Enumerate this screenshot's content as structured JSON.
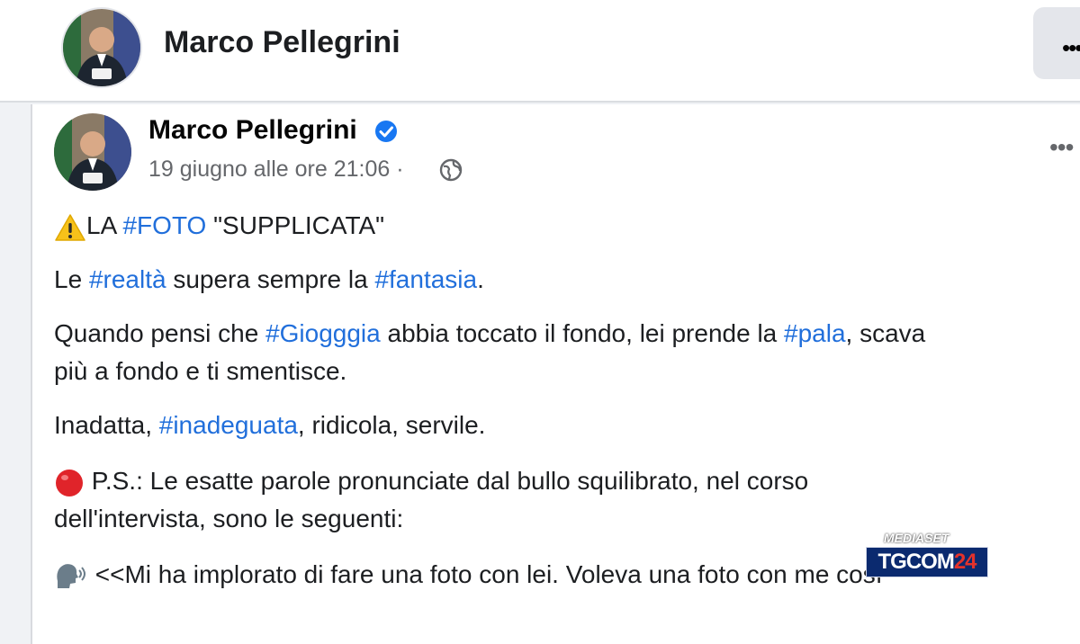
{
  "header": {
    "name": "Marco Pellegrini"
  },
  "post": {
    "author": "Marco Pellegrini",
    "timestamp": "19 giugno alle ore 21:06",
    "meta_separator": "·",
    "paragraphs": {
      "p1": {
        "a": "LA ",
        "tag1": "#FOTO",
        "b": " \"SUPPLICATA\""
      },
      "p2": {
        "a": "Le ",
        "tag1": "#realtà",
        "b": " supera sempre la ",
        "tag2": "#fantasia",
        "c": "."
      },
      "p3": {
        "a": "Quando pensi che ",
        "tag1": "#Giogggia",
        "b": " abbia toccato il fondo, lei prende la ",
        "tag2": "#pala",
        "c": ", scava"
      },
      "p3b": "più a fondo e ti smentisce.",
      "p4": {
        "a": "Inadatta, ",
        "tag1": "#inadeguata",
        "b": ", ridicola, servile."
      },
      "p5": " P.S.: Le esatte parole pronunciate dal bullo squilibrato, nel corso",
      "p5b": "dell'intervista, sono le seguenti:",
      "p6": " <<Mi ha implorato di fare una foto con lei. Voleva una foto con me così"
    }
  },
  "watermark": {
    "top": "MEDIASET",
    "main": "TGCOM",
    "num": "24"
  },
  "icons": {
    "verified": "verified-badge-icon",
    "globe": "globe-icon",
    "warning": "warning-icon",
    "red_dot": "red-circle-icon",
    "speaking_head": "speaking-head-icon"
  },
  "colors": {
    "hashtag": "#216fdb",
    "verified": "#1877f2"
  }
}
